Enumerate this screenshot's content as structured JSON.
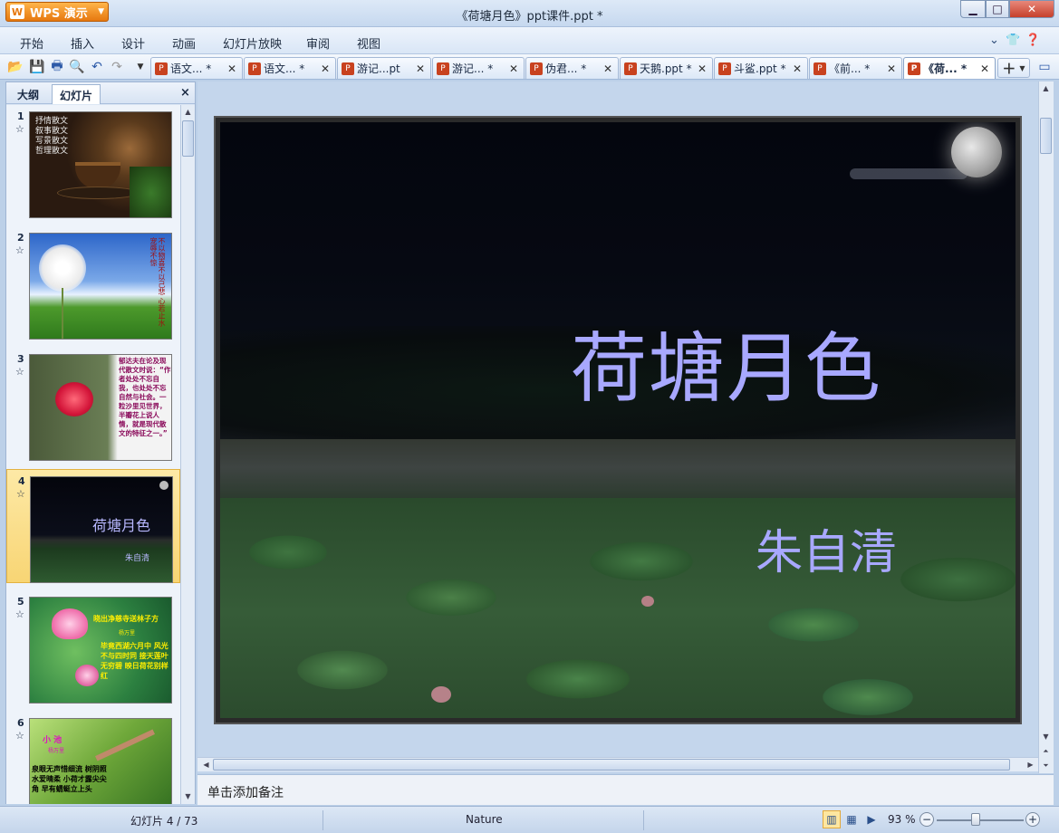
{
  "app": {
    "name": "WPS 演示",
    "window_title": "《荷塘月色》ppt课件.ppt *"
  },
  "menu": [
    "开始",
    "插入",
    "设计",
    "动画",
    "幻灯片放映",
    "审阅",
    "视图"
  ],
  "tabs": [
    {
      "label": "语文... *"
    },
    {
      "label": "语文... *"
    },
    {
      "label": "游记...pt"
    },
    {
      "label": "游记... *"
    },
    {
      "label": "伪君... *"
    },
    {
      "label": "天鹅.ppt *"
    },
    {
      "label": "斗鲨.ppt *"
    },
    {
      "label": "《前... *"
    },
    {
      "label": "《荷... *",
      "active": true
    }
  ],
  "panel": {
    "tab_outline": "大纲",
    "tab_slides": "幻灯片",
    "close": "×"
  },
  "thumbnails": [
    {
      "num": "1",
      "lines": [
        "抒情散文",
        "叙事散文",
        "写景散文",
        "哲理散文"
      ]
    },
    {
      "num": "2",
      "text": "不以物喜不以己悲 心若止水 宠辱不惊"
    },
    {
      "num": "3",
      "text": "郁达夫在论及现代散文时说：“作者处处不忘自我，也处处不忘自然与社会。一粒沙里见世界，半瓣花上说人情，就是现代散文的特征之一。”"
    },
    {
      "num": "4",
      "title": "荷塘月色",
      "sub": "朱自清",
      "selected": true
    },
    {
      "num": "5",
      "title": "晓出净慈寺送林子方",
      "author": "杨万里",
      "text": "毕竟西湖六月中 风光不与四时同 接天莲叶无穷碧 映日荷花别样红"
    },
    {
      "num": "6",
      "title": "小 池",
      "author": "杨万里",
      "text": "泉眼无声惜细流 树阴照水爱晴柔 小荷才露尖尖角 早有蜻蜓立上头"
    }
  ],
  "slide": {
    "title": "荷塘月色",
    "author": "朱自清"
  },
  "notes": {
    "placeholder": "单击添加备注"
  },
  "status": {
    "slide_pos": "幻灯片 4 / 73",
    "theme": "Nature",
    "zoom": "93 %"
  }
}
